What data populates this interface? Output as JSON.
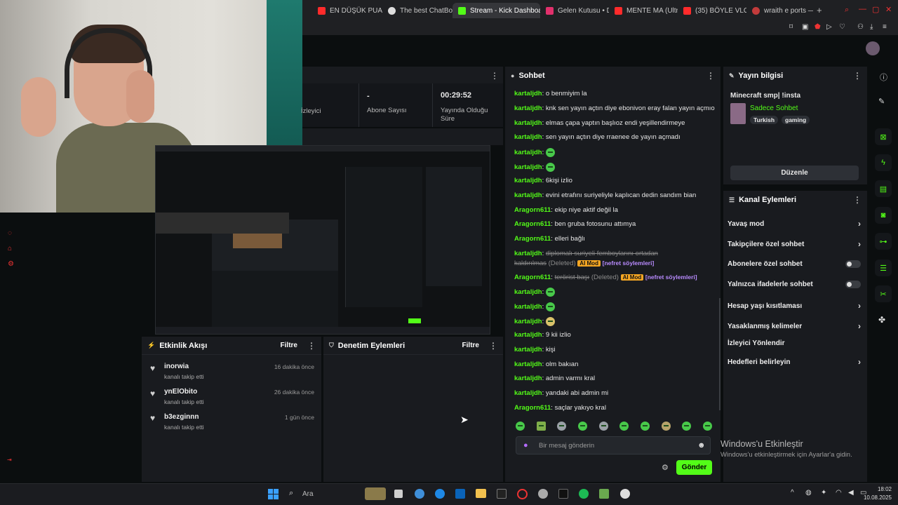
{
  "browser": {
    "tabs": [
      {
        "label": "EN DÜŞÜK PUAN",
        "color": "#ff2b2b"
      },
      {
        "label": "The best ChatBo",
        "color": "#dddddd"
      },
      {
        "label": "Stream - Kick Dashboard",
        "color": "#53fc18"
      },
      {
        "label": "Gelen Kutusu • D",
        "color": "#e1306c"
      },
      {
        "label": "MENTE MA (Ultra",
        "color": "#ff2b2b"
      },
      {
        "label": "(35) BÖYLE VLOG",
        "color": "#ff2b2b"
      },
      {
        "label": "wraith e ports —",
        "color": "#c23b3b"
      }
    ],
    "new_tab": "+"
  },
  "stats": {
    "left_label": "İzleyici",
    "subs_value": "-",
    "subs_label": "Abone Sayısı",
    "time_value": "00:29:52",
    "time_label": "Yayında Olduğu Süre"
  },
  "chat": {
    "title": "Sohbet",
    "messages": [
      {
        "user": "kartaljdh",
        "text": "o benmiyim la"
      },
      {
        "user": "kartaljdh",
        "text": "knk sen yayın açtın diye ebonivon eray falan yayın açmıo"
      },
      {
        "user": "kartaljdh",
        "text": "elmas çapa yaptın başlıoz endi yeşillendirmeye"
      },
      {
        "user": "kartaljdh",
        "text": "sen yayın açtın diye rraenee de yayın açmadı"
      },
      {
        "user": "kartaljdh",
        "text": ""
      },
      {
        "user": "kartaljdh",
        "text": ""
      },
      {
        "user": "kartaljdh",
        "text": "6kişi izlio"
      },
      {
        "user": "kartaljdh",
        "text": "evini etrafını suriyeliyle kaplıcan dedin sandım bian"
      },
      {
        "user": "Aragorn611",
        "text": "ekip niye aktif değil la"
      },
      {
        "user": "Aragorn611",
        "text": "ben gruba fotosunu attımya"
      },
      {
        "user": "Aragorn611",
        "text": "elleri bağlı"
      }
    ],
    "deleted1": {
      "user": "kartaljdh",
      "text_a": "diplomalı suriyeli femboylarını ortadan",
      "text_b": "kaldırılmas",
      "deleted": "(Deleted)",
      "badge": "AI Mod",
      "tag": "[nefret söylemleri]"
    },
    "deleted2": {
      "user": "Aragorn611",
      "text": "terörist başı",
      "deleted": "(Deleted)",
      "badge": "AI Mod",
      "tag": "[nefret söylemleri]"
    },
    "messages2": [
      {
        "user": "kartaljdh",
        "text": ""
      },
      {
        "user": "kartaljdh",
        "text": ""
      },
      {
        "user": "kartaljdh",
        "text": ""
      },
      {
        "user": "kartaljdh",
        "text": "9 kii izlio"
      },
      {
        "user": "kartaljdh",
        "text": "kişi"
      },
      {
        "user": "kartaljdh",
        "text": "olm bakıan"
      },
      {
        "user": "kartaljdh",
        "text": "admin varmı kral"
      },
      {
        "user": "kartaljdh",
        "text": "yandaki abi admin mi"
      },
      {
        "user": "Aragorn611",
        "text": "saçlar yakıyo kral"
      }
    ],
    "placeholder": "Bir mesaj gönderin",
    "send": "Gönder"
  },
  "stream_info": {
    "title": "Yayın bilgisi",
    "stream_title": "Minecraft smp| !insta",
    "category": "Sadece Sohbet",
    "tags": [
      "Turkish",
      "gaming"
    ],
    "edit": "Düzenle"
  },
  "channel_actions": {
    "title": "Kanal Eylemleri",
    "items": [
      {
        "label": "Yavaş mod",
        "control": "chevron"
      },
      {
        "label": "Takipçilere özel sohbet",
        "control": "chevron"
      },
      {
        "label": "Abonelere özel sohbet",
        "control": "toggle"
      },
      {
        "label": "Yalnızca ifadelerle sohbet",
        "control": "toggle"
      },
      {
        "label": "Hesap yaşı kısıtlaması",
        "control": "chevron"
      },
      {
        "label": "Yasaklanmış kelimeler",
        "control": "chevron"
      },
      {
        "label": "İzleyici Yönlendir",
        "control": "none"
      },
      {
        "label": "Hedefleri belirleyin",
        "control": "chevron"
      }
    ]
  },
  "activity": {
    "title": "Etkinlik Akışı",
    "filter": "Filtre",
    "items": [
      {
        "user": "inorwia",
        "action": "kanalı takip etti",
        "time": "16 dakika önce"
      },
      {
        "user": "ynElObito",
        "action": "kanalı takip etti",
        "time": "26 dakika önce"
      },
      {
        "user": "b3ezginnn",
        "action": "kanalı takip etti",
        "time": "1 gün önce"
      }
    ]
  },
  "moderation": {
    "title": "Denetim Eylemleri",
    "filter": "Filtre"
  },
  "windows": {
    "line1": "Windows'u Etkinleştir",
    "line2": "Windows'u etkinleştirmek için Ayarlar'a gidin."
  },
  "taskbar": {
    "search": "Ara",
    "time": "18:02",
    "date": "10.08.2025"
  }
}
